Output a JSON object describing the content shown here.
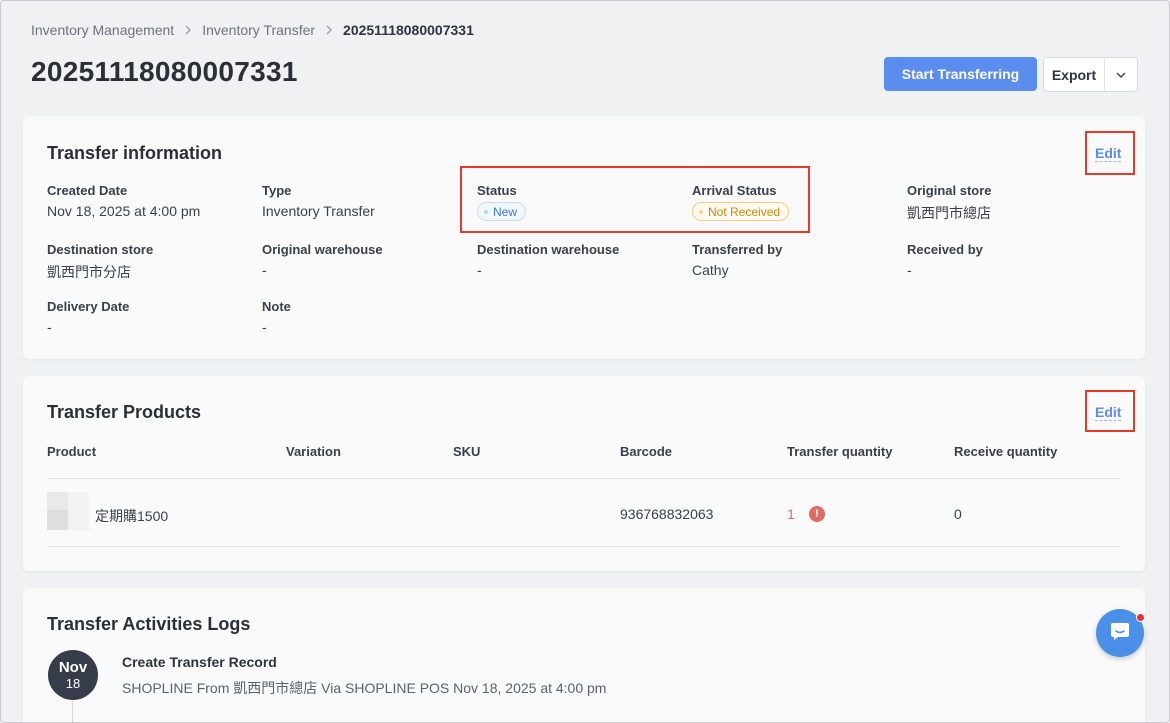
{
  "breadcrumb": {
    "items": [
      "Inventory Management",
      "Inventory Transfer"
    ],
    "current": "20251118080007331"
  },
  "page": {
    "title": "20251118080007331"
  },
  "actions": {
    "primary_label": "Start Transferring",
    "export_label": "Export"
  },
  "transfer_info": {
    "title": "Transfer information",
    "edit_label": "Edit",
    "fields": {
      "created_date": {
        "label": "Created Date",
        "value": "Nov 18, 2025 at 4:00 pm"
      },
      "type": {
        "label": "Type",
        "value": "Inventory Transfer"
      },
      "status": {
        "label": "Status",
        "value": "New"
      },
      "arrival_status": {
        "label": "Arrival Status",
        "value": "Not Received"
      },
      "original_store": {
        "label": "Original store",
        "value": "凱西門市總店"
      },
      "destination_store": {
        "label": "Destination store",
        "value": "凱西門市分店"
      },
      "original_warehouse": {
        "label": "Original warehouse",
        "value": "-"
      },
      "destination_warehouse": {
        "label": "Destination warehouse",
        "value": "-"
      },
      "transferred_by": {
        "label": "Transferred by",
        "value": "Cathy"
      },
      "received_by": {
        "label": "Received by",
        "value": "-"
      },
      "delivery_date": {
        "label": "Delivery Date",
        "value": "-"
      },
      "note": {
        "label": "Note",
        "value": "-"
      }
    }
  },
  "transfer_products": {
    "title": "Transfer Products",
    "edit_label": "Edit",
    "columns": [
      "Product",
      "Variation",
      "SKU",
      "Barcode",
      "Transfer quantity",
      "Receive quantity"
    ],
    "rows": [
      {
        "product": "定期購1500",
        "variation": "",
        "sku": "",
        "barcode": "936768832063",
        "transfer_quantity": "1",
        "receive_quantity": "0"
      }
    ]
  },
  "activity_logs": {
    "title": "Transfer Activities Logs",
    "entries": [
      {
        "month": "Nov",
        "day": "18",
        "title": "Create Transfer Record",
        "description": "SHOPLINE From 凱西門市總店 Via SHOPLINE POS Nov 18, 2025 at 4:00 pm"
      }
    ]
  },
  "colors": {
    "primary": "#5b8def",
    "highlight": "#e53b2c",
    "status_new": "#3b79d8",
    "status_not_received": "#d08a0c",
    "alert": "#e06b62"
  },
  "icons": {
    "breadcrumb_separator": "chevron-right-icon",
    "export_caret": "chevron-down-icon",
    "quantity_alert": "exclamation-icon",
    "chat": "chat-bubble-icon"
  }
}
